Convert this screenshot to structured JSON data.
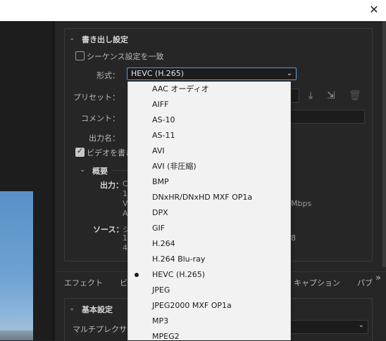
{
  "titlebar": {
    "close_glyph": "✕"
  },
  "export_settings": {
    "section_title": "書き出し設定",
    "match_sequence_label": "シーケンス設定を一致",
    "format_label": "形式：",
    "format_value": "HEVC (H.265)",
    "preset_label": "プリセット：",
    "comment_label": "コメント：",
    "output_name_label": "出力名：",
    "export_video_label": "ビデオを書き",
    "summary": {
      "title": "概要",
      "output_label": "出力：",
      "output_lines": [
        "C",
        "1",
        "V",
        "A"
      ],
      "bitrate_suffix": "Mbps",
      "source_label": "ソース：",
      "source_lines": [
        "シ",
        "1",
        "4"
      ],
      "source_suffix": "8"
    }
  },
  "tabs": [
    "エフェクト",
    "ビ",
    "キャプション",
    "パブ"
  ],
  "tabs_more": "»",
  "basic_settings": {
    "section_title": "基本設定",
    "multiplexer_label": "マルチプレクサー"
  },
  "format_options": [
    "AAC オーディオ",
    "AIFF",
    "AS-10",
    "AS-11",
    "AVI",
    "AVI (非圧縮)",
    "BMP",
    "DNxHR/DNxHD MXF OP1a",
    "DPX",
    "GIF",
    "H.264",
    "H.264 Blu-ray",
    "HEVC (H.265)",
    "JPEG",
    "JPEG2000 MXF OP1a",
    "MP3",
    "MPEG2"
  ],
  "selected_format_index": 12,
  "icons": [
    "close-icon",
    "chevron-down-icon",
    "save-preset-icon",
    "import-preset-icon",
    "delete-preset-icon"
  ]
}
